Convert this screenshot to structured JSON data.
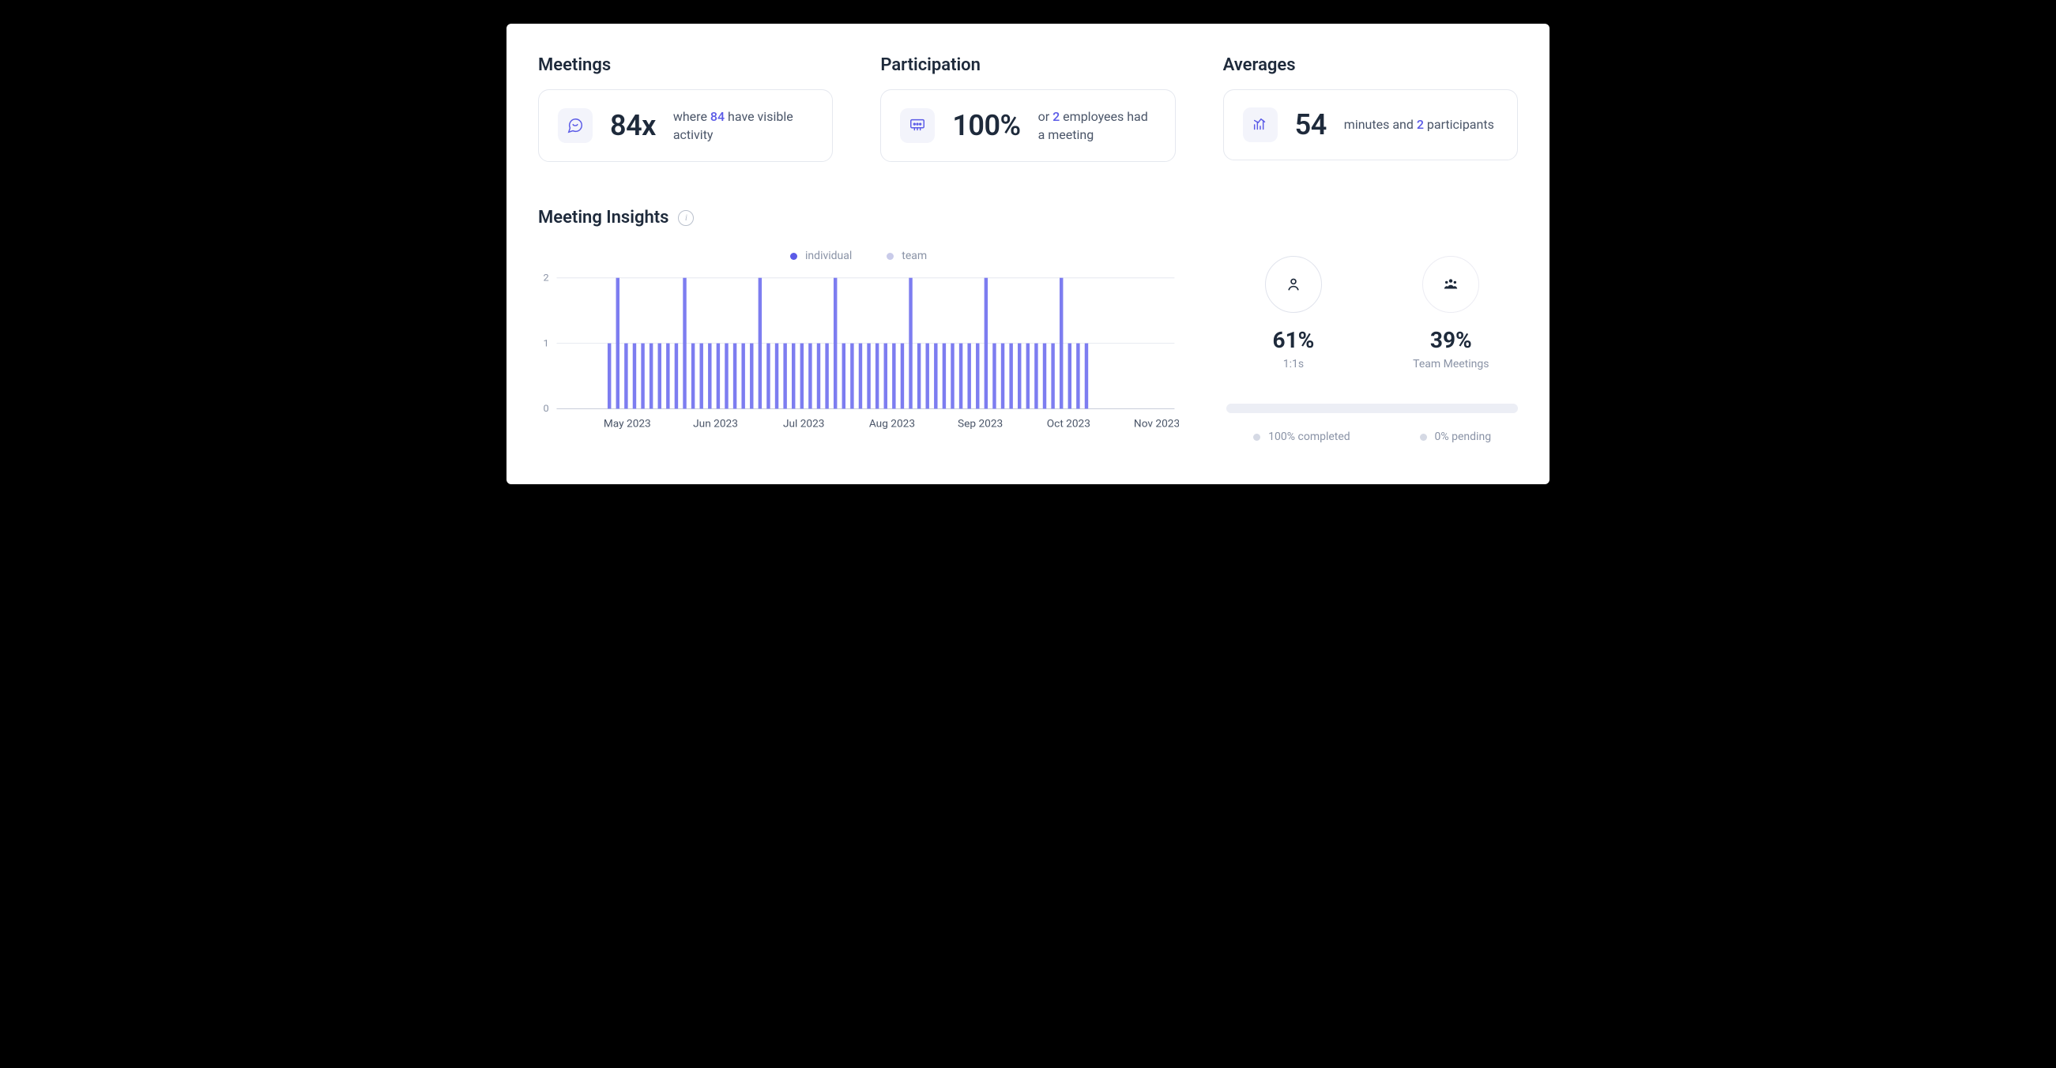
{
  "metrics": {
    "meetings": {
      "title": "Meetings",
      "value": "84x",
      "desc_pre": "where ",
      "desc_accent": "84",
      "desc_post": " have visible activity"
    },
    "participation": {
      "title": "Participation",
      "value": "100%",
      "desc_pre": "or ",
      "desc_accent": "2",
      "desc_post": " employees had a meeting"
    },
    "averages": {
      "title": "Averages",
      "value": "54",
      "desc_pre": "minutes and ",
      "desc_accent": "2",
      "desc_post": " participants"
    }
  },
  "insights": {
    "title": "Meeting Insights",
    "legend_individual": "individual",
    "legend_team": "team",
    "distribution": {
      "one_on_one_pct": "61%",
      "one_on_one_label": "1:1s",
      "team_pct": "39%",
      "team_label": "Team Meetings"
    },
    "status": {
      "completed": "100% completed",
      "pending": "0% pending"
    }
  },
  "chart_data": {
    "type": "bar",
    "title": "Meeting Insights",
    "xlabel": "",
    "ylabel": "",
    "ylim": [
      0,
      2
    ],
    "y_ticks": [
      0,
      1,
      2
    ],
    "x_labels": [
      "May 2023",
      "Jun 2023",
      "Jul 2023",
      "Aug 2023",
      "Sep 2023",
      "Oct 2023",
      "Nov 2023"
    ],
    "legend": [
      "individual",
      "team"
    ],
    "series": [
      {
        "name": "individual",
        "values": [
          1,
          2,
          1,
          1,
          1,
          1,
          1,
          1,
          1,
          2,
          1,
          1,
          1,
          1,
          1,
          1,
          1,
          1,
          2,
          1,
          1,
          1,
          1,
          1,
          1,
          1,
          1,
          2,
          1,
          1,
          1,
          1,
          1,
          1,
          1,
          1,
          2,
          1,
          1,
          1,
          1,
          1,
          1,
          1,
          1,
          2,
          1,
          1,
          1,
          1,
          1,
          1,
          1,
          1,
          2,
          1,
          1,
          1
        ]
      },
      {
        "name": "team",
        "values": [
          0,
          0,
          0,
          0,
          0,
          0,
          0,
          0,
          0,
          0,
          0,
          0,
          0,
          0,
          0,
          0,
          0,
          0,
          0,
          0,
          0,
          0,
          0,
          0,
          0,
          0,
          0,
          0,
          0,
          0,
          0,
          0,
          0,
          0,
          0,
          0,
          0,
          0,
          0,
          0,
          0,
          0,
          0,
          0,
          0,
          0,
          0,
          0,
          0,
          0,
          0,
          0,
          0,
          0,
          0,
          0,
          0,
          0
        ]
      }
    ]
  }
}
